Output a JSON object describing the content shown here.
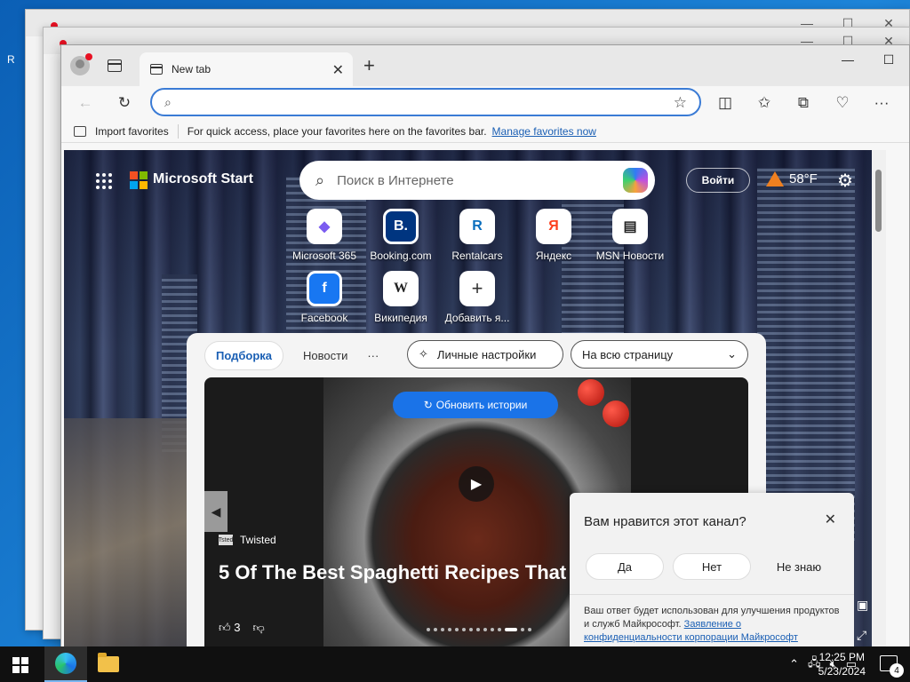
{
  "desktop": {
    "stray_text": "R"
  },
  "browser": {
    "tab_title": "New tab",
    "address_value": "",
    "favorites_bar": {
      "import_label": "Import favorites",
      "hint": "For quick access, place your favorites here on the favorites bar.",
      "manage_link": "Manage favorites now"
    }
  },
  "page": {
    "brand": "Microsoft Start",
    "search_placeholder": "Поиск в Интернете",
    "login_label": "Войти",
    "temperature": "58°F",
    "tiles": [
      {
        "label": "Microsoft 365",
        "icon": "microsoft365-icon",
        "glyph": "◆"
      },
      {
        "label": "Booking.com",
        "icon": "booking-icon",
        "glyph": "B."
      },
      {
        "label": "Rentalcars",
        "icon": "rentalcars-icon",
        "glyph": "R"
      },
      {
        "label": "Яндекс",
        "icon": "yandex-icon",
        "glyph": "Я"
      },
      {
        "label": "MSN Новости",
        "icon": "msn-news-icon",
        "glyph": "▤"
      },
      {
        "label": "Facebook",
        "icon": "facebook-icon",
        "glyph": "f"
      },
      {
        "label": "Википедия",
        "icon": "wikipedia-icon",
        "glyph": "W"
      },
      {
        "label": "Добавить я...",
        "icon": "add-icon",
        "glyph": "+"
      }
    ],
    "feed": {
      "tab_active": "Подборка",
      "tab_news": "Новости",
      "more": "···",
      "personalize": "Личные настройки",
      "layout_select": "На всю страницу",
      "refresh_label": "Обновить истории",
      "source": "Twisted",
      "source_logo": "Tsted",
      "headline": "5 Of The Best Spaghetti Recipes That Make",
      "likes": "3"
    },
    "popup": {
      "question": "Вам нравится этот канал?",
      "yes": "Да",
      "no": "Нет",
      "dont_know": "Не знаю",
      "note": "Ваш ответ будет использован для улучшения продуктов и служб Майкрософт.",
      "privacy_link": "Заявление о конфиденциальности корпорации Майкрософт"
    }
  },
  "taskbar": {
    "time": "12:25 PM",
    "date": "5/23/2024",
    "notifications": "4"
  },
  "colors": {
    "accent": "#1a73e8",
    "ms_red": "#f25022",
    "ms_green": "#7fba00",
    "ms_blue": "#00a4ef",
    "ms_yellow": "#ffb900"
  }
}
